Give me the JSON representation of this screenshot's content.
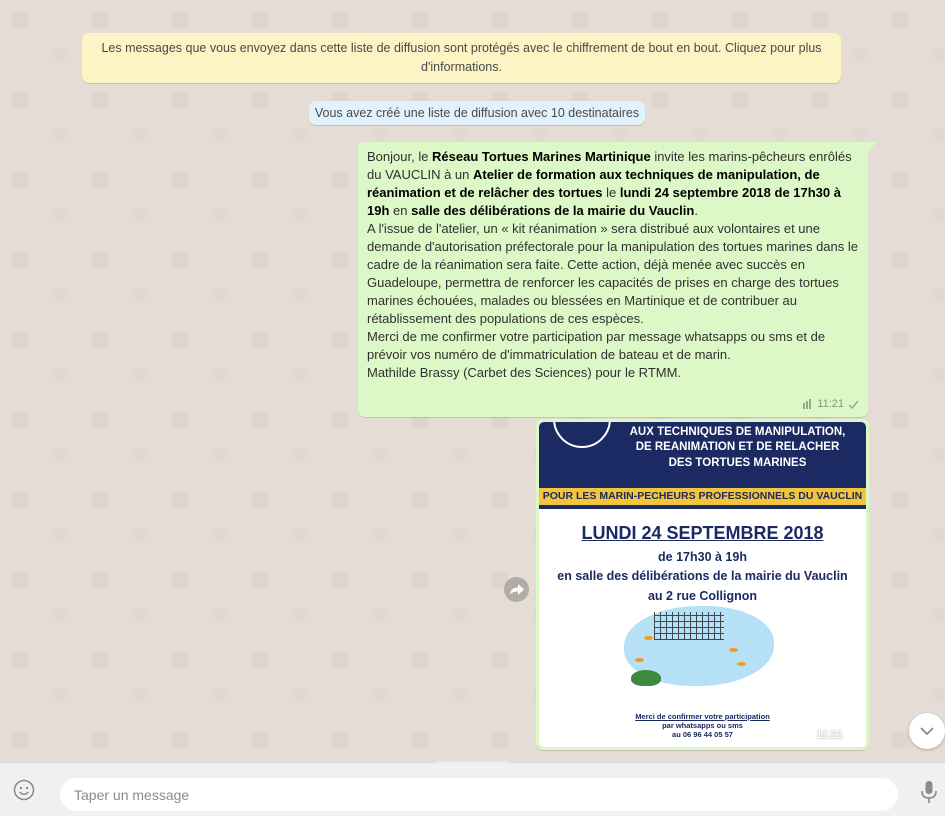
{
  "chat": {
    "encryption_notice": "Les messages que vous envoyez dans cette liste de diffusion sont protégés avec le chiffrement de bout en bout. Cliquez pour plus d'informations.",
    "system_message": "Vous avez créé une liste de diffusion avec 10 destinataires",
    "text_message": {
      "p1_a": "Bonjour, le ",
      "p1_b": "Réseau Tortues Marines Martinique",
      "p1_c": " invite les marins-pêcheurs enrôlés du VAUCLIN à un ",
      "p1_d": "Atelier de formation aux techniques de manipulation, de réanimation et de relâcher des tortues",
      "p1_e": "  le ",
      "p1_f": "lundi 24 septembre 2018 de 17h30 à 19h",
      "p1_g": " en ",
      "p1_h": "salle des délibérations de la mairie du Vauclin",
      "p1_i": ".",
      "p2": "A l'issue de l'atelier, un « kit réanimation » sera distribué aux volontaires et une demande d'autorisation préfectorale pour la manipulation des tortues marines dans le cadre de la réanimation sera faite. Cette action, déjà menée avec succès en Guadeloupe, permettra de renforcer les capacités de prises en charge des tortues marines échouées, malades ou blessées en Martinique et de contribuer au rétablissement des populations de ces espèces.",
      "p3": "Merci de me confirmer votre participation par message whatsapps ou sms et de prévoir vos numéro de d'immatriculation de bateau et de marin.",
      "p4": "Mathilde Brassy (Carbet des Sciences) pour le RTMM.",
      "time": "11:21"
    },
    "image_message": {
      "poster_line1": "AUX TECHNIQUES DE MANIPULATION,",
      "poster_line2": "DE REANIMATION ET DE RELACHER",
      "poster_line3": "DES TORTUES MARINES",
      "poster_band": "POUR LES MARIN-PECHEURS PROFESSIONNELS DU VAUCLIN",
      "poster_date": "LUNDI 24 SEPTEMBRE 2018",
      "poster_time": "de 17h30 à 19h",
      "poster_place": "en salle des délibérations de la mairie du Vauclin",
      "poster_address": "au 2 rue Collignon",
      "poster_foot1": "Merci de confirmer votre participation",
      "poster_foot2": "par whatsapps ou sms",
      "poster_foot3": "au 06 96 44 05 57",
      "time": "11:21"
    }
  },
  "compose": {
    "placeholder": "Taper un message"
  },
  "icons": {
    "emoji": "emoji-icon",
    "mic": "mic-icon",
    "forward": "forward-icon",
    "scroll_down": "chevron-down-icon",
    "check": "check-icon",
    "media": "media-icon"
  },
  "colors": {
    "outgoing_bubble": "#dcf8c6",
    "encryption_bg": "#fcf4c4",
    "system_bg": "#e1f2fb",
    "poster_navy": "#1b2a63",
    "poster_yellow": "#f2c53a"
  }
}
